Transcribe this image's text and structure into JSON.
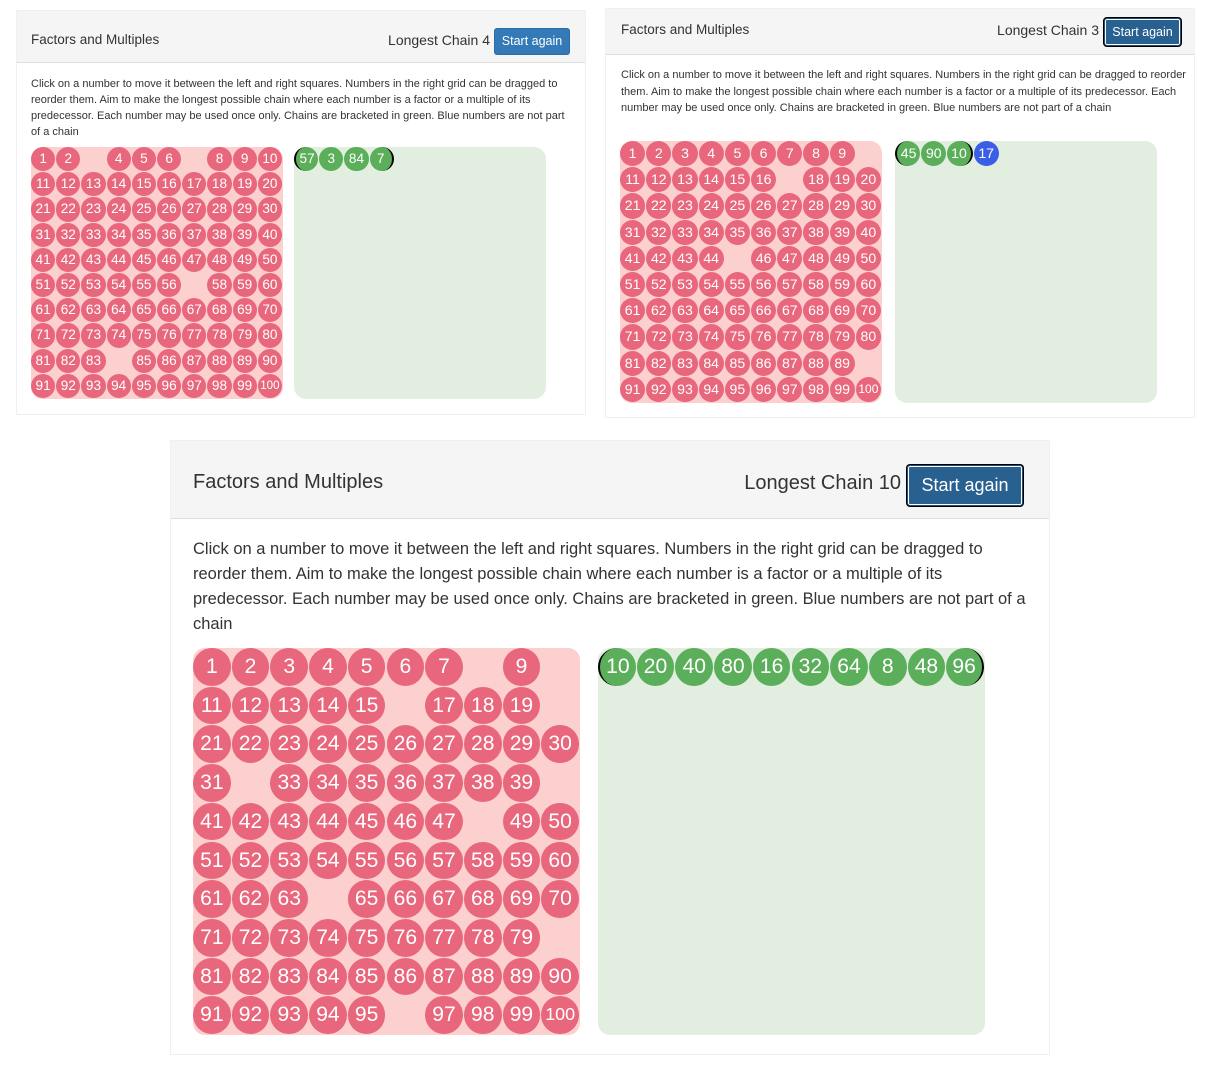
{
  "panels": [
    {
      "title": "Factors and Multiples",
      "chain_label": "Longest Chain 4",
      "button_label": "Start again",
      "button_focused": false,
      "instructions": "Click on a number to move it between the left and right squares. Numbers in the right grid can be dragged to reorder them. Aim to make the longest possible chain where each number is a factor or a multiple of its predecessor. Each number may be used once only. Chains are bracketed in green. Blue numbers are not part of a chain",
      "removed_numbers": [
        3,
        7,
        57,
        84
      ],
      "chain": [
        {
          "n": 57,
          "color": "green",
          "bracket": "left"
        },
        {
          "n": 3,
          "color": "green",
          "bracket": ""
        },
        {
          "n": 84,
          "color": "green",
          "bracket": ""
        },
        {
          "n": 7,
          "color": "green",
          "bracket": "right"
        }
      ]
    },
    {
      "title": "Factors and Multiples",
      "chain_label": "Longest Chain 3",
      "button_label": "Start again",
      "button_focused": true,
      "instructions": "Click on a number to move it between the left and right squares. Numbers in the right grid can be dragged to reorder them. Aim to make the longest possible chain where each number is a factor or a multiple of its predecessor. Each number may be used once only. Chains are bracketed in green. Blue numbers are not part of a chain",
      "removed_numbers": [
        10,
        17,
        45,
        90
      ],
      "chain": [
        {
          "n": 45,
          "color": "green",
          "bracket": "left"
        },
        {
          "n": 90,
          "color": "green",
          "bracket": ""
        },
        {
          "n": 10,
          "color": "green",
          "bracket": "right"
        },
        {
          "n": 17,
          "color": "blue",
          "bracket": ""
        }
      ]
    },
    {
      "title": "Factors and Multiples",
      "chain_label": "Longest Chain 10",
      "button_label": "Start again",
      "button_focused": true,
      "instructions": "Click on a number to move it between the left and right squares. Numbers in the right grid can be dragged to reorder them. Aim to make the longest possible chain where each number is a factor or a multiple of its predecessor. Each number may be used once only. Chains are bracketed in green. Blue numbers are not part of a chain",
      "removed_numbers": [
        8,
        10,
        16,
        20,
        32,
        40,
        48,
        64,
        80,
        96
      ],
      "chain": [
        {
          "n": 10,
          "color": "green",
          "bracket": "left"
        },
        {
          "n": 20,
          "color": "green",
          "bracket": ""
        },
        {
          "n": 40,
          "color": "green",
          "bracket": ""
        },
        {
          "n": 80,
          "color": "green",
          "bracket": ""
        },
        {
          "n": 16,
          "color": "green",
          "bracket": ""
        },
        {
          "n": 32,
          "color": "green",
          "bracket": ""
        },
        {
          "n": 64,
          "color": "green",
          "bracket": ""
        },
        {
          "n": 8,
          "color": "green",
          "bracket": ""
        },
        {
          "n": 48,
          "color": "green",
          "bracket": ""
        },
        {
          "n": 96,
          "color": "green",
          "bracket": "right"
        }
      ]
    }
  ],
  "colors": {
    "available": "#e8677d",
    "chain": "#5bae5a",
    "unchained": "#3b5ee6",
    "left_bg": "#fdd0d0",
    "right_bg": "#e2eee0",
    "button": "#337ab7"
  }
}
